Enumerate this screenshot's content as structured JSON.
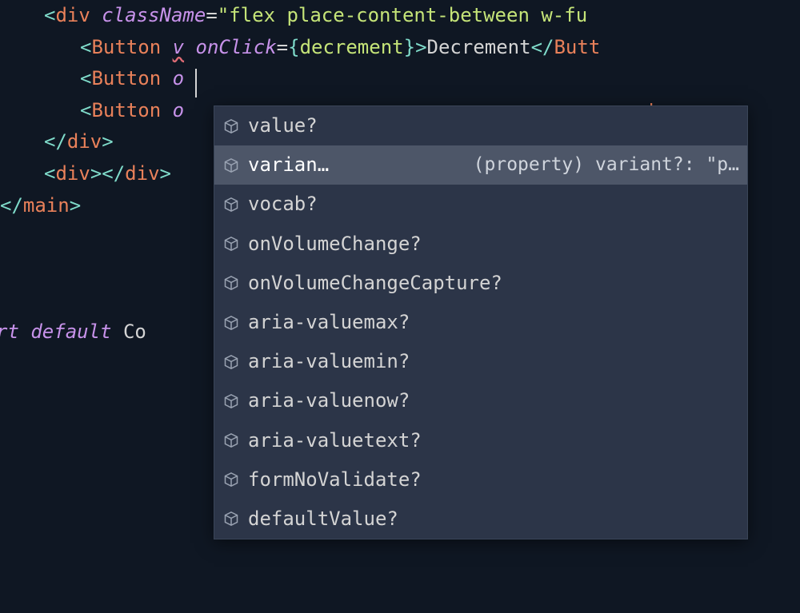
{
  "code": {
    "lines": [
      {
        "indentClass": "l1",
        "tokens": [
          {
            "t": "<",
            "c": "punct-br"
          },
          {
            "t": "div",
            "c": "tag-name"
          },
          {
            "t": " className",
            "c": "attr-name"
          },
          {
            "t": "=",
            "c": "eq"
          },
          {
            "t": "\"flex place-content-between w-fu",
            "c": "string"
          }
        ]
      },
      {
        "indentClass": "l2",
        "tokens": [
          {
            "t": "<",
            "c": "punct-br"
          },
          {
            "t": "Button",
            "c": "tag-name"
          },
          {
            "t": " ",
            "c": "punct"
          },
          {
            "t": "v",
            "c": "attr-name",
            "squiggle": true
          },
          {
            "t": " onClick",
            "c": "attr-name"
          },
          {
            "t": "=",
            "c": "eq"
          },
          {
            "t": "{",
            "c": "brace"
          },
          {
            "t": "decrement",
            "c": "method"
          },
          {
            "t": "}",
            "c": "brace"
          },
          {
            "t": ">",
            "c": "punct-br"
          },
          {
            "t": "Decrement",
            "c": "text-content"
          },
          {
            "t": "</",
            "c": "punct-br"
          },
          {
            "t": "Butt",
            "c": "tag-name"
          }
        ]
      },
      {
        "indentClass": "l2",
        "tokens": [
          {
            "t": "<",
            "c": "punct-br"
          },
          {
            "t": "Button",
            "c": "tag-name"
          },
          {
            "t": " o",
            "c": "attr-name"
          }
        ]
      },
      {
        "indentClass": "l2",
        "tokens": [
          {
            "t": "<",
            "c": "punct-br"
          },
          {
            "t": "Button",
            "c": "tag-name"
          },
          {
            "t": " o",
            "c": "attr-name"
          },
          {
            "t": "                                        ",
            "c": "punct"
          },
          {
            "t": "ton",
            "c": "tag-name"
          }
        ]
      },
      {
        "indentClass": "l1",
        "tokens": [
          {
            "t": "</",
            "c": "punct-br"
          },
          {
            "t": "div",
            "c": "tag-name"
          },
          {
            "t": ">",
            "c": "punct-br"
          }
        ]
      },
      {
        "indentClass": "l1",
        "tokens": [
          {
            "t": "<",
            "c": "punct-br"
          },
          {
            "t": "div",
            "c": "tag-name"
          },
          {
            "t": "></",
            "c": "punct-br"
          },
          {
            "t": "div",
            "c": "tag-name"
          },
          {
            "t": ">",
            "c": "punct-br"
          }
        ]
      },
      {
        "indentClass": "l0",
        "tokens": [
          {
            "t": "</",
            "c": "punct-br"
          },
          {
            "t": "main",
            "c": "tag-name"
          },
          {
            "t": ">",
            "c": "punct-br"
          }
        ]
      },
      {
        "indentClass": "l0",
        "tokens": []
      },
      {
        "indentClass": "l0",
        "tokens": []
      },
      {
        "indentClass": "l0",
        "tokens": []
      },
      {
        "indentClass": "l0",
        "cutoff": true,
        "tokens": [
          {
            "t": "rt",
            "c": "keyword"
          },
          {
            "t": " default",
            "c": "keyword"
          },
          {
            "t": " Co",
            "c": "class-name"
          }
        ]
      }
    ]
  },
  "autocomplete": {
    "selectedIndex": 1,
    "items": [
      {
        "label": "value?",
        "detail": ""
      },
      {
        "label": "varian…",
        "detail": "(property) variant?: \"p…"
      },
      {
        "label": "vocab?",
        "detail": ""
      },
      {
        "label": "onVolumeChange?",
        "detail": ""
      },
      {
        "label": "onVolumeChangeCapture?",
        "detail": ""
      },
      {
        "label": "aria-valuemax?",
        "detail": ""
      },
      {
        "label": "aria-valuemin?",
        "detail": ""
      },
      {
        "label": "aria-valuenow?",
        "detail": ""
      },
      {
        "label": "aria-valuetext?",
        "detail": ""
      },
      {
        "label": "formNoValidate?",
        "detail": ""
      },
      {
        "label": "defaultValue?",
        "detail": ""
      }
    ]
  }
}
